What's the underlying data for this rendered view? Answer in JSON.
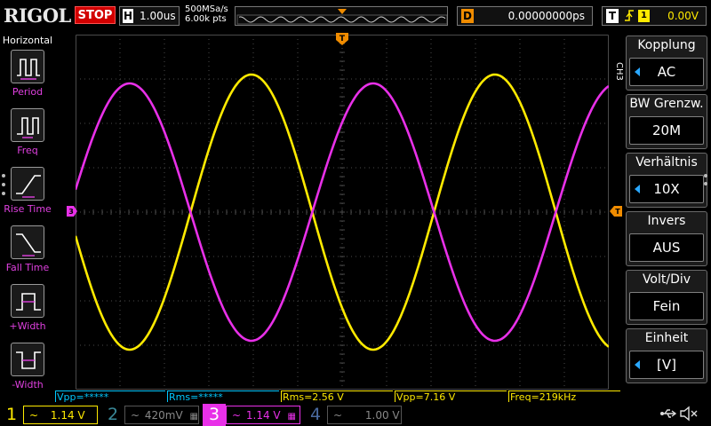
{
  "topbar": {
    "logo": "RIGOL",
    "run_state": "STOP",
    "horizontal": {
      "letter": "H",
      "value": "1.00us"
    },
    "acquisition": {
      "sample_rate": "500MSa/s",
      "memory_depth": "6.00k pts"
    },
    "delay": {
      "letter": "D",
      "value": "0.00000000ps"
    },
    "trigger": {
      "letter": "T",
      "edge_icon": "rising-edge-icon",
      "source": "1",
      "level": "0.00V"
    }
  },
  "left_menu": {
    "title": "Horizontal",
    "items": [
      {
        "label": "Period",
        "icon": "period-icon"
      },
      {
        "label": "Freq",
        "icon": "frequency-icon"
      },
      {
        "label": "Rise Time",
        "icon": "rise-time-icon"
      },
      {
        "label": "Fall Time",
        "icon": "fall-time-icon"
      },
      {
        "label": "+Width",
        "icon": "positive-width-icon"
      },
      {
        "label": "-Width",
        "icon": "negative-width-icon"
      }
    ]
  },
  "right_menu": {
    "channel": "CH3",
    "items": [
      {
        "title": "Kopplung",
        "value": "AC",
        "has_arrow": true
      },
      {
        "title": "BW Grenzw.",
        "value": "20M",
        "has_arrow": false
      },
      {
        "title": "Verhältnis",
        "value": "10X",
        "has_arrow": true
      },
      {
        "title": "Invers",
        "value": "AUS",
        "has_arrow": false
      },
      {
        "title": "Volt/Div",
        "value": "Fein",
        "has_arrow": false
      },
      {
        "title": "Einheit",
        "value": "[V]",
        "has_arrow": true
      }
    ]
  },
  "measurements": [
    {
      "text": "Vpp=*****",
      "color": "#00c8ff"
    },
    {
      "text": "Rms=*****",
      "color": "#00c8ff"
    },
    {
      "text": "Rms=2.56 V",
      "color": "#ffea00"
    },
    {
      "text": "Vpp=7.16 V",
      "color": "#ffea00"
    },
    {
      "text": "Freq=219kHz",
      "color": "#ffea00"
    }
  ],
  "channels": [
    {
      "num": "1",
      "coupling": "~",
      "scale": "1.14 V",
      "color": "#ffea00",
      "active": false,
      "enabled": true
    },
    {
      "num": "2",
      "coupling": "~",
      "scale": "420mV",
      "color": "#3a8a9a",
      "active": false,
      "enabled": false
    },
    {
      "num": "3",
      "coupling": "~",
      "scale": "1.14 V",
      "color": "#e830e8",
      "active": true,
      "enabled": true
    },
    {
      "num": "4",
      "coupling": "~",
      "scale": "1.00 V",
      "color": "#4a6aa0",
      "active": false,
      "enabled": false
    }
  ],
  "colors": {
    "ch1": "#ffea00",
    "ch3": "#e830e8",
    "grid": "#4a4a4a",
    "accent_blue": "#2aa8ff",
    "trigger_orange": "#f08c00"
  },
  "waveforms": [
    {
      "channel": "1",
      "type": "sine",
      "periods_on_screen": 2.19,
      "amplitude_divisions": 3.1,
      "phase_deg": 190
    },
    {
      "channel": "3",
      "type": "sine",
      "periods_on_screen": 2.19,
      "amplitude_divisions": 2.9,
      "phase_deg": 10
    }
  ]
}
